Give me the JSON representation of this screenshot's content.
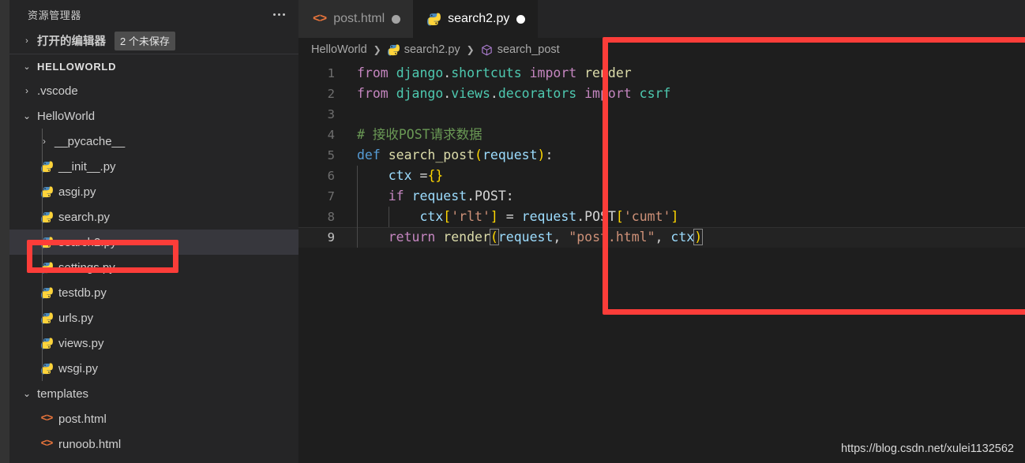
{
  "sidebar": {
    "title": "资源管理器",
    "more_icon": "ellipsis-icon",
    "open_editors": {
      "label": "打开的编辑器",
      "badge": "2 个未保存",
      "twisty": "›"
    },
    "root": {
      "label": "HELLOWORLD",
      "twisty": "⌄"
    },
    "tree": [
      {
        "label": ".vscode",
        "kind": "folder",
        "depth": 1,
        "expanded": false,
        "icon": "chevron-right-icon",
        "selected": false
      },
      {
        "label": "HelloWorld",
        "kind": "folder",
        "depth": 1,
        "expanded": true,
        "icon": "chevron-down-icon",
        "selected": false
      },
      {
        "label": "__pycache__",
        "kind": "folder",
        "depth": 2,
        "expanded": false,
        "icon": "chevron-right-icon",
        "selected": false
      },
      {
        "label": "__init__.py",
        "kind": "python",
        "depth": 2,
        "icon": "python-file-icon",
        "selected": false
      },
      {
        "label": "asgi.py",
        "kind": "python",
        "depth": 2,
        "icon": "python-file-icon",
        "selected": false
      },
      {
        "label": "search.py",
        "kind": "python",
        "depth": 2,
        "icon": "python-file-icon",
        "selected": false
      },
      {
        "label": "search2.py",
        "kind": "python",
        "depth": 2,
        "icon": "python-file-icon",
        "selected": true
      },
      {
        "label": "settings.py",
        "kind": "python",
        "depth": 2,
        "icon": "python-file-icon",
        "selected": false
      },
      {
        "label": "testdb.py",
        "kind": "python",
        "depth": 2,
        "icon": "python-file-icon",
        "selected": false
      },
      {
        "label": "urls.py",
        "kind": "python",
        "depth": 2,
        "icon": "python-file-icon",
        "selected": false
      },
      {
        "label": "views.py",
        "kind": "python",
        "depth": 2,
        "icon": "python-file-icon",
        "selected": false
      },
      {
        "label": "wsgi.py",
        "kind": "python",
        "depth": 2,
        "icon": "python-file-icon",
        "selected": false
      },
      {
        "label": "templates",
        "kind": "folder",
        "depth": 1,
        "expanded": true,
        "icon": "chevron-down-icon",
        "selected": false
      },
      {
        "label": "post.html",
        "kind": "html",
        "depth": 2,
        "icon": "html-file-icon",
        "selected": false
      },
      {
        "label": "runoob.html",
        "kind": "html",
        "depth": 2,
        "icon": "html-file-icon",
        "selected": false
      }
    ]
  },
  "tabs": [
    {
      "label": "post.html",
      "icon": "html-file-icon",
      "active": false,
      "dirty": true
    },
    {
      "label": "search2.py",
      "icon": "python-file-icon",
      "active": true,
      "dirty": true
    }
  ],
  "breadcrumbs": [
    {
      "label": "HelloWorld",
      "icon": null
    },
    {
      "label": "search2.py",
      "icon": "python-file-icon"
    },
    {
      "label": "search_post",
      "icon": "symbol-method-icon"
    }
  ],
  "breadcrumb_separator": "❯",
  "editor": {
    "active_line": 9,
    "lines": [
      {
        "n": 1,
        "tokens": [
          {
            "t": "from",
            "c": "t-kw"
          },
          {
            "t": " ",
            "c": "t-plain"
          },
          {
            "t": "django",
            "c": "t-mod"
          },
          {
            "t": ".",
            "c": "t-plain"
          },
          {
            "t": "shortcuts",
            "c": "t-mod"
          },
          {
            "t": " ",
            "c": "t-plain"
          },
          {
            "t": "import",
            "c": "t-kw"
          },
          {
            "t": " ",
            "c": "t-plain"
          },
          {
            "t": "render",
            "c": "t-fn"
          }
        ]
      },
      {
        "n": 2,
        "tokens": [
          {
            "t": "from",
            "c": "t-kw"
          },
          {
            "t": " ",
            "c": "t-plain"
          },
          {
            "t": "django",
            "c": "t-mod"
          },
          {
            "t": ".",
            "c": "t-plain"
          },
          {
            "t": "views",
            "c": "t-mod"
          },
          {
            "t": ".",
            "c": "t-plain"
          },
          {
            "t": "decorators",
            "c": "t-mod"
          },
          {
            "t": " ",
            "c": "t-plain"
          },
          {
            "t": "import",
            "c": "t-kw"
          },
          {
            "t": " ",
            "c": "t-plain"
          },
          {
            "t": "csrf",
            "c": "t-mod"
          }
        ]
      },
      {
        "n": 3,
        "tokens": []
      },
      {
        "n": 4,
        "tokens": [
          {
            "t": "# 接收POST请求数据",
            "c": "t-cmt"
          }
        ]
      },
      {
        "n": 5,
        "tokens": [
          {
            "t": "def",
            "c": "t-kw2"
          },
          {
            "t": " ",
            "c": "t-plain"
          },
          {
            "t": "search_post",
            "c": "t-fn"
          },
          {
            "t": "(",
            "c": "t-b1"
          },
          {
            "t": "request",
            "c": "t-var"
          },
          {
            "t": ")",
            "c": "t-b1"
          },
          {
            "t": ":",
            "c": "t-plain"
          }
        ]
      },
      {
        "n": 6,
        "tokens": [
          {
            "t": "    ",
            "c": "t-plain"
          },
          {
            "t": "ctx",
            "c": "t-var"
          },
          {
            "t": " =",
            "c": "t-plain"
          },
          {
            "t": "{",
            "c": "t-b1"
          },
          {
            "t": "}",
            "c": "t-b1"
          }
        ]
      },
      {
        "n": 7,
        "tokens": [
          {
            "t": "    ",
            "c": "t-plain"
          },
          {
            "t": "if",
            "c": "t-kw"
          },
          {
            "t": " ",
            "c": "t-plain"
          },
          {
            "t": "request",
            "c": "t-var"
          },
          {
            "t": ".",
            "c": "t-plain"
          },
          {
            "t": "POST",
            "c": "t-plain"
          },
          {
            "t": ":",
            "c": "t-plain"
          }
        ]
      },
      {
        "n": 8,
        "tokens": [
          {
            "t": "        ",
            "c": "t-plain"
          },
          {
            "t": "ctx",
            "c": "t-var"
          },
          {
            "t": "[",
            "c": "t-b1"
          },
          {
            "t": "'rlt'",
            "c": "t-str"
          },
          {
            "t": "]",
            "c": "t-b1"
          },
          {
            "t": " = ",
            "c": "t-plain"
          },
          {
            "t": "request",
            "c": "t-var"
          },
          {
            "t": ".",
            "c": "t-plain"
          },
          {
            "t": "POST",
            "c": "t-plain"
          },
          {
            "t": "[",
            "c": "t-b1"
          },
          {
            "t": "'cumt'",
            "c": "t-str"
          },
          {
            "t": "]",
            "c": "t-b1"
          }
        ]
      },
      {
        "n": 9,
        "tokens": [
          {
            "t": "    ",
            "c": "t-plain"
          },
          {
            "t": "return",
            "c": "t-kw"
          },
          {
            "t": " ",
            "c": "t-plain"
          },
          {
            "t": "render",
            "c": "t-fn"
          },
          {
            "t": "(",
            "c": "t-b1 bracket-match"
          },
          {
            "t": "request",
            "c": "t-var"
          },
          {
            "t": ", ",
            "c": "t-plain"
          },
          {
            "t": "\"post.html\"",
            "c": "t-str"
          },
          {
            "t": ", ",
            "c": "t-plain"
          },
          {
            "t": "ctx",
            "c": "t-var"
          },
          {
            "t": ")",
            "c": "t-b1 bracket-match"
          }
        ]
      }
    ]
  },
  "annotations": [
    {
      "name": "sidebar-highlight",
      "color": "#fc3d39",
      "target": "search2.py"
    },
    {
      "name": "editor-highlight",
      "color": "#fc3d39",
      "target": "code-block"
    }
  ],
  "watermark": "https://blog.csdn.net/xulei1132562"
}
